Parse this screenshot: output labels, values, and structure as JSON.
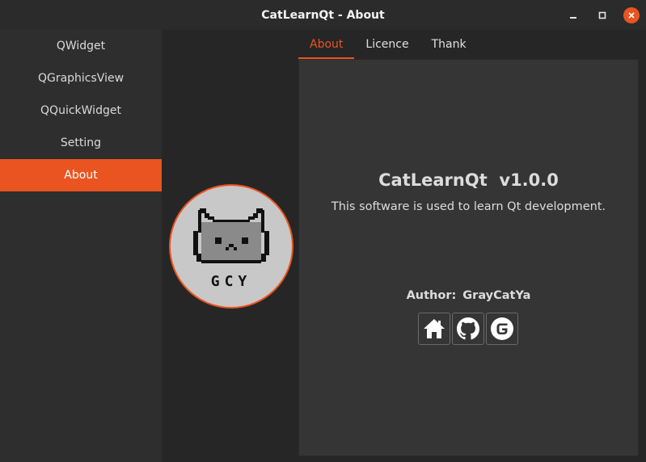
{
  "window": {
    "title": "CatLearnQt - About",
    "controls": [
      "minimize-icon",
      "maximize-icon",
      "close-icon"
    ]
  },
  "sidebar": {
    "items": [
      {
        "label": "QWidget",
        "active": false
      },
      {
        "label": "QGraphicsView",
        "active": false
      },
      {
        "label": "QQuickWidget",
        "active": false
      },
      {
        "label": "Setting",
        "active": false
      },
      {
        "label": "About",
        "active": true
      }
    ]
  },
  "avatar": {
    "text": "GCY",
    "icon": "pixel-cat-icon"
  },
  "tabs": [
    {
      "label": "About",
      "active": true
    },
    {
      "label": "Licence",
      "active": false
    },
    {
      "label": "Thank",
      "active": false
    }
  ],
  "about": {
    "app_title": "CatLearnQt  v1.0.0",
    "description": "This software is used to learn Qt development.",
    "author_label": "Author:",
    "author_name": "GrayCatYa",
    "links": [
      {
        "icon": "home-icon"
      },
      {
        "icon": "github-icon"
      },
      {
        "icon": "gitee-icon"
      }
    ]
  },
  "colors": {
    "accent": "#e95420",
    "background": "#262626",
    "sidebar": "#2e2e2e",
    "panel": "#353535"
  }
}
